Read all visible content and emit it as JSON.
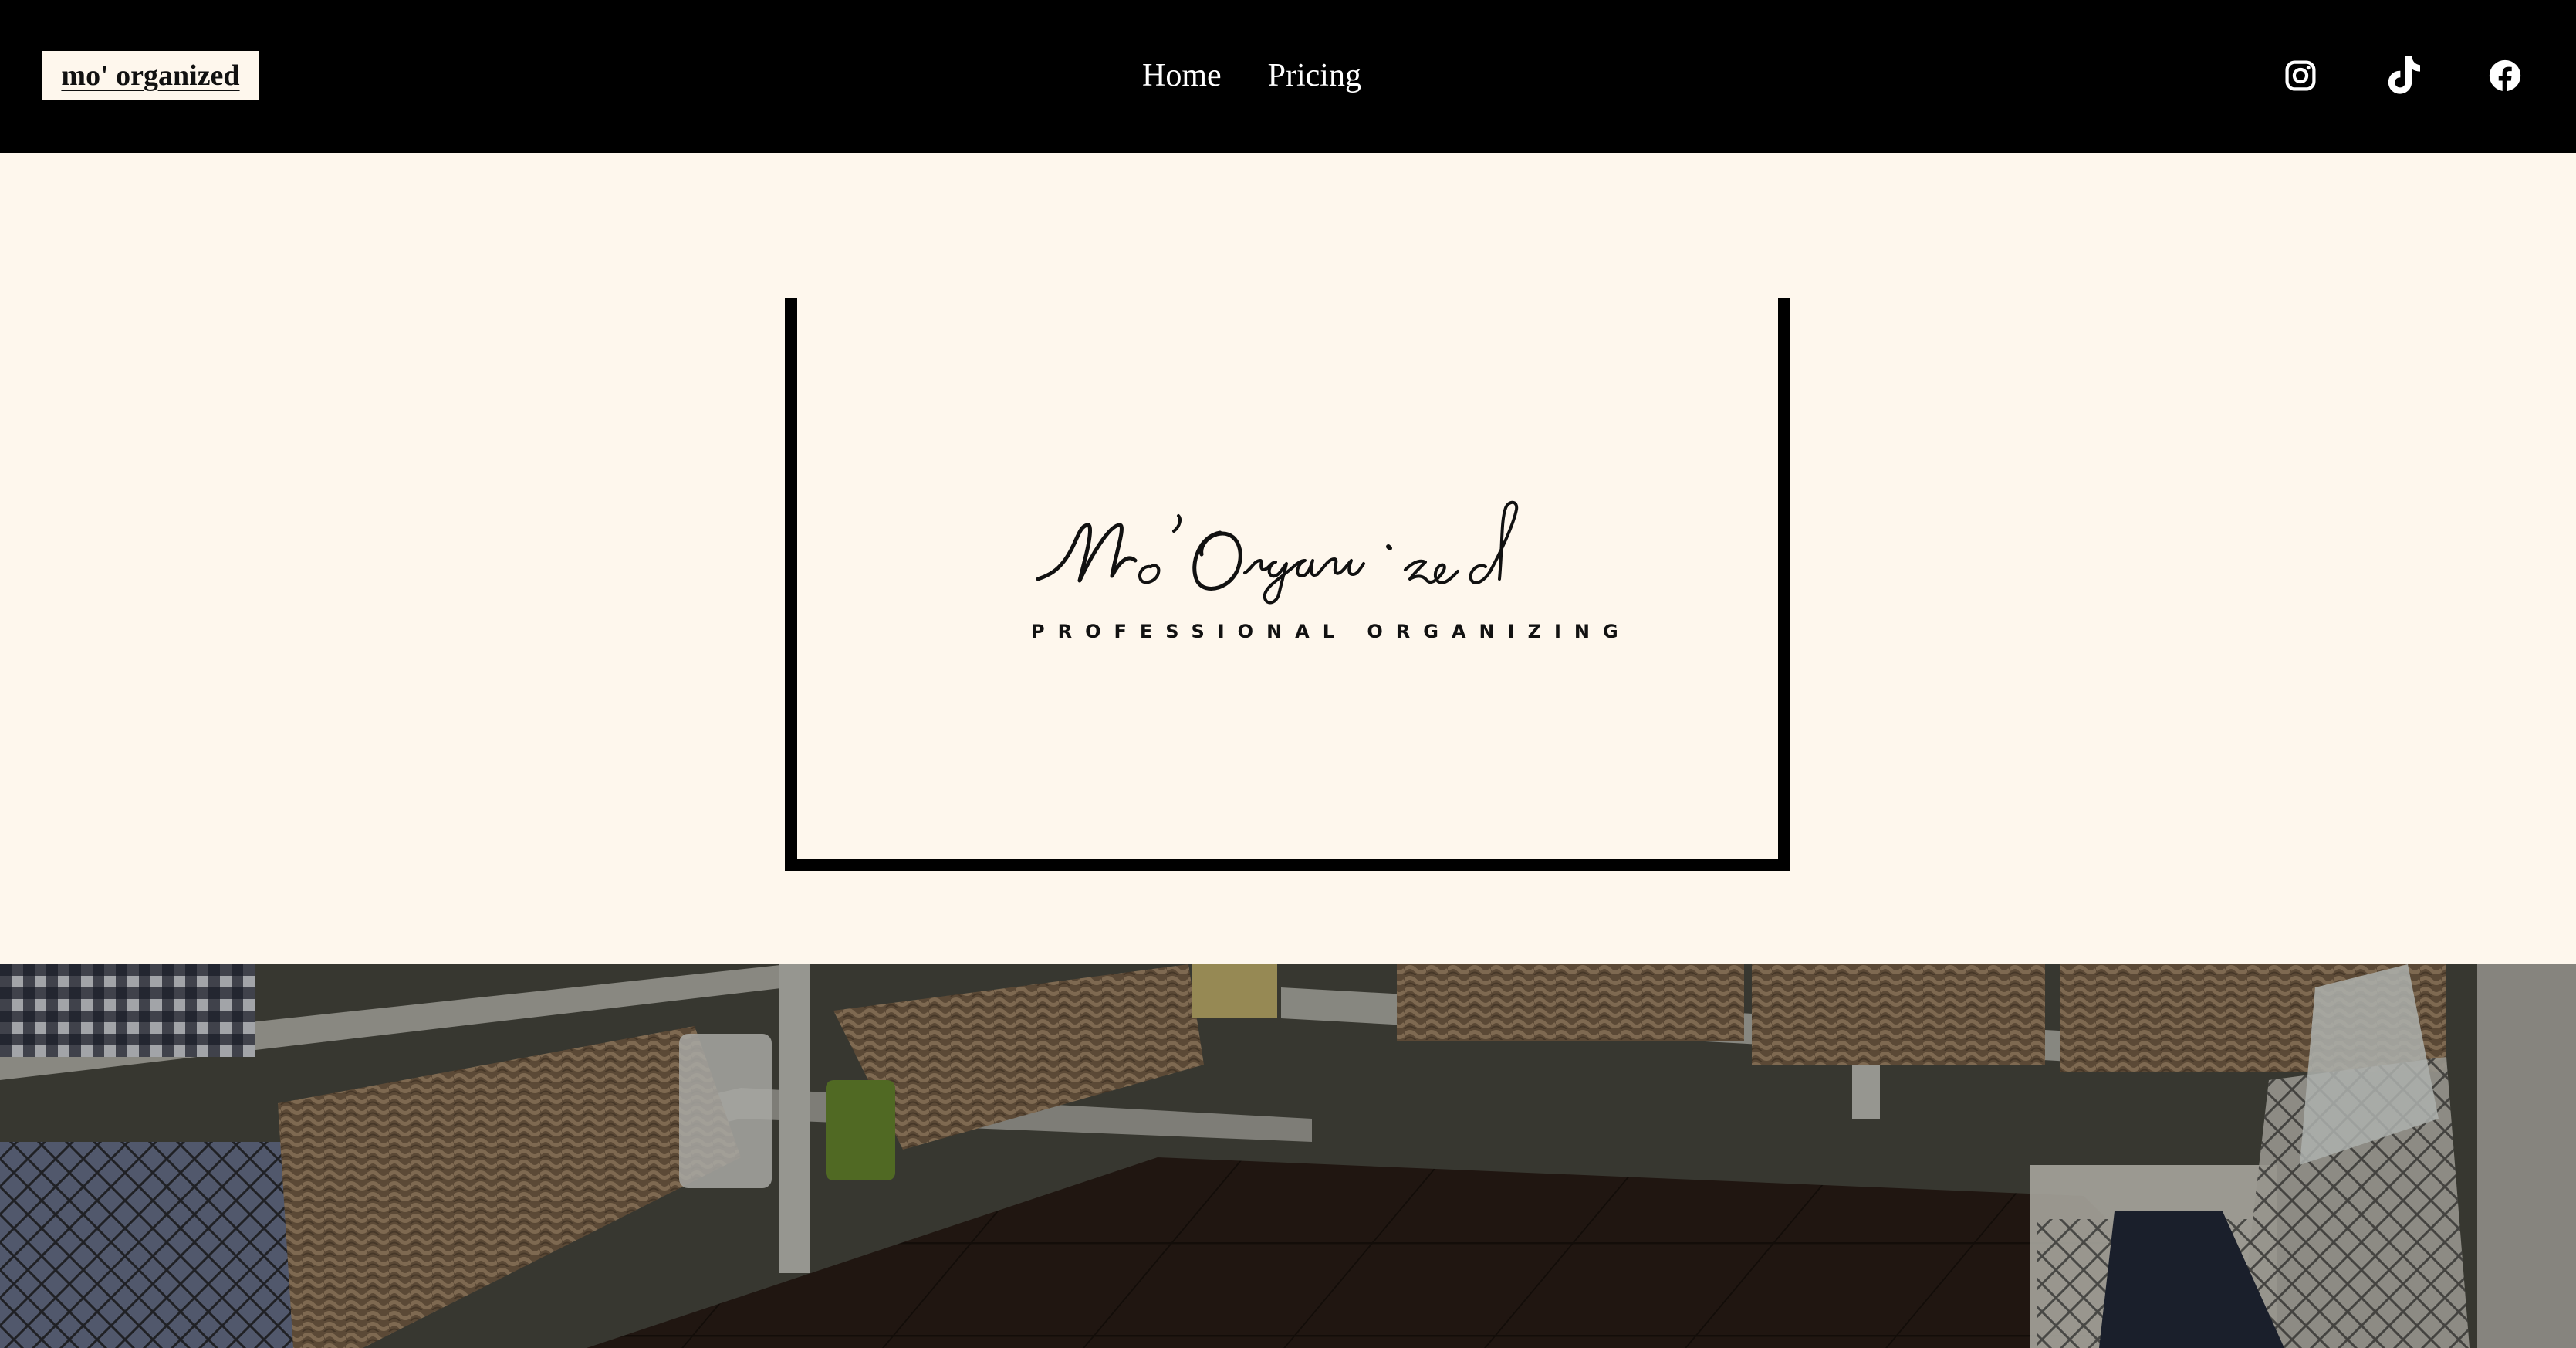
{
  "header": {
    "brand": "mo' organized",
    "nav": [
      "Home",
      "Pricing"
    ]
  },
  "social": [
    {
      "name": "Instagram",
      "icon": "instagram-icon"
    },
    {
      "name": "TikTok",
      "icon": "tiktok-icon"
    },
    {
      "name": "Facebook",
      "icon": "facebook-icon"
    }
  ],
  "logo": {
    "script": "Mo'Organized",
    "tagline": "PROFESSIONAL ORGANIZING"
  },
  "colors": {
    "topbar": "#000000",
    "page_background": "#fef7ed",
    "text": "#111111"
  }
}
